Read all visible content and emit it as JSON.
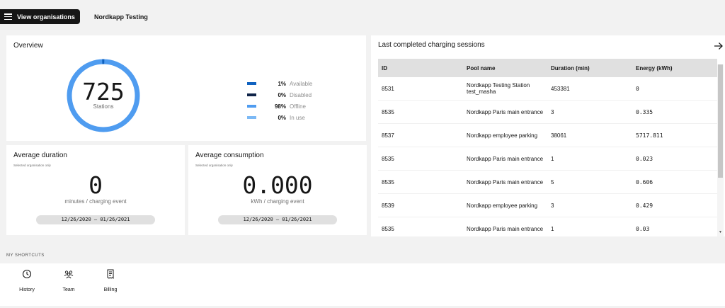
{
  "header": {
    "view_orgs_label": "View organisations",
    "org_name": "Nordkapp Testing"
  },
  "overview": {
    "title": "Overview",
    "total": "725",
    "total_label": "Stations",
    "legend": [
      {
        "pct": "1%",
        "label": "Available",
        "color": "#1062c0",
        "value": 1
      },
      {
        "pct": "0%",
        "label": "Disabled",
        "color": "#0f2448",
        "value": 0
      },
      {
        "pct": "98%",
        "label": "Offline",
        "color": "#4f9cf0",
        "value": 98
      },
      {
        "pct": "0%",
        "label": "In use",
        "color": "#7cb9f5",
        "value": 0
      }
    ]
  },
  "avg_duration": {
    "title": "Average duration",
    "subtitle": "Selected organisation only",
    "value": "0",
    "unit": "minutes / charging event",
    "date_range": "12/26/2020 – 01/26/2021"
  },
  "avg_consumption": {
    "title": "Average consumption",
    "subtitle": "Selected organisation only",
    "value": "0.000",
    "unit": "kWh / charging event",
    "date_range": "12/26/2020 – 01/26/2021"
  },
  "sessions": {
    "title": "Last completed charging sessions",
    "columns": [
      "ID",
      "Pool name",
      "Duration (min)",
      "Energy (kWh)"
    ],
    "rows": [
      {
        "id": "8531",
        "pool": "Nordkapp Testing Station test_masha",
        "duration": "453381",
        "energy": "0"
      },
      {
        "id": "8535",
        "pool": "Nordkapp Paris main entrance",
        "duration": "3",
        "energy": "0.335"
      },
      {
        "id": "8537",
        "pool": "Nordkapp employee parking",
        "duration": "38061",
        "energy": "5717.811"
      },
      {
        "id": "8535",
        "pool": "Nordkapp Paris main entrance",
        "duration": "1",
        "energy": "0.023"
      },
      {
        "id": "8535",
        "pool": "Nordkapp Paris main entrance",
        "duration": "5",
        "energy": "0.606"
      },
      {
        "id": "8539",
        "pool": "Nordkapp employee parking",
        "duration": "3",
        "energy": "0.429"
      },
      {
        "id": "8535",
        "pool": "Nordkapp Paris main entrance",
        "duration": "1",
        "energy": "0.03"
      }
    ]
  },
  "shortcuts": {
    "label": "MY SHORTCUTS",
    "items": [
      {
        "label": "History",
        "icon": "history-icon"
      },
      {
        "label": "Team",
        "icon": "team-icon"
      },
      {
        "label": "Billing",
        "icon": "billing-icon"
      }
    ]
  }
}
